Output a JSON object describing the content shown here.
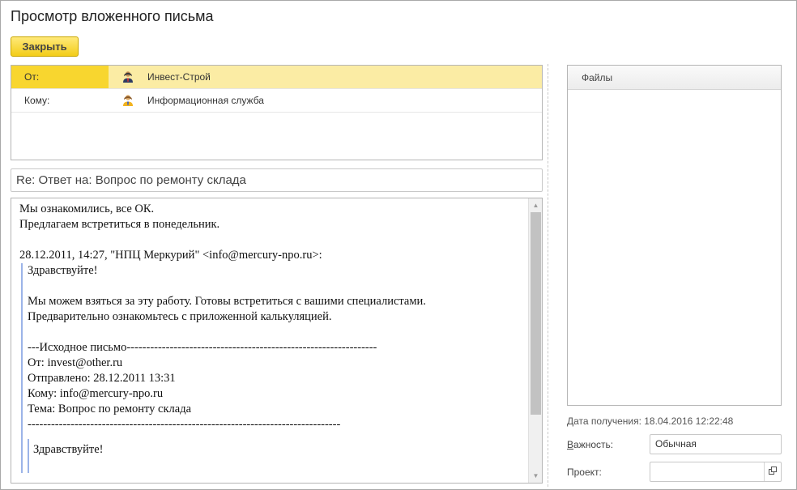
{
  "window": {
    "title": "Просмотр вложенного письма"
  },
  "toolbar": {
    "close_label": "Закрыть"
  },
  "recipients": [
    {
      "label": "От:",
      "name": "Инвест-Строй",
      "icon": "user-dark-icon",
      "selected": true
    },
    {
      "label": "Кому:",
      "name": "Информационная служба",
      "icon": "user-yellow-icon",
      "selected": false
    }
  ],
  "subject": "Re: Ответ на: Вопрос по ремонту склада",
  "body": {
    "line1": "Мы ознакомились, все ОК.",
    "line2": "Предлагаем встретиться в понедельник.",
    "quote_header": "28.12.2011, 14:27, \"НПЦ Меркурий\" <info@mercury-npo.ru>:",
    "q_greeting": "Здравствуйте!",
    "q_line1": "Мы можем взяться за эту работу. Готовы встретиться с вашими специалистами.",
    "q_line2": "Предварительно ознакомьтесь с приложенной калькуляцией.",
    "orig_header": "---Исходное письмо----------------------------------------------------------------",
    "orig_from": "От: invest@other.ru",
    "orig_sent": "Отправлено: 28.12.2011 13:31",
    "orig_to": "Кому: info@mercury-npo.ru",
    "orig_subject": "Тема: Вопрос по ремонту склада",
    "orig_sep": "--------------------------------------------------------------------------------",
    "q2_greeting": "Здравствуйте!"
  },
  "files": {
    "header": "Файлы"
  },
  "received": {
    "label": "Дата получения:",
    "value": "18.04.2016 12:22:48"
  },
  "importance": {
    "label_first": "В",
    "label_rest": "ажность:",
    "value": "Обычная"
  },
  "project": {
    "label": "Проект:",
    "value": ""
  },
  "colors": {
    "accent": "#f8d62f",
    "selected_row": "#fbeca4",
    "quote_bar": "#9cb4e8"
  }
}
